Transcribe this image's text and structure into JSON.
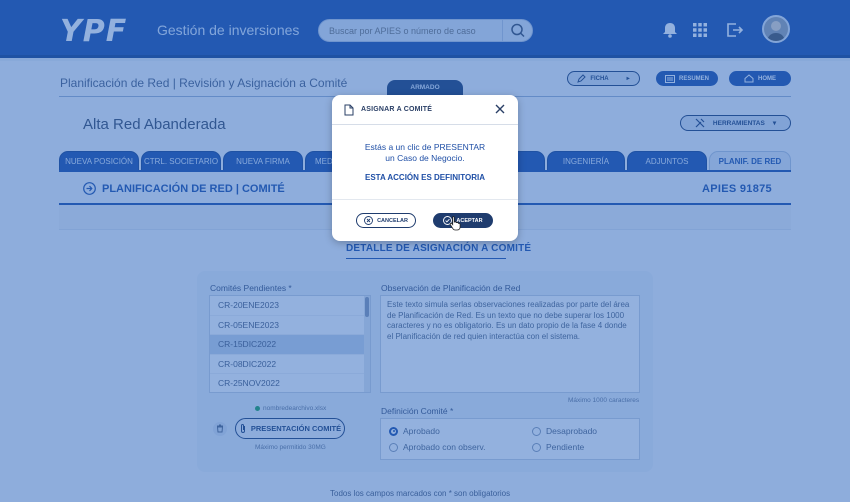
{
  "header": {
    "logo": "YPF",
    "app_title": "Gestión de inversiones",
    "search_placeholder": "Buscar por APIES o número de caso"
  },
  "breadcrumb": "Planificación de Red | Revisión y Asignación a Comité",
  "armado_tab": "ARMADO",
  "header_buttons": {
    "ficha": "FICHA",
    "resumen": "RESUMEN",
    "home": "HOME"
  },
  "subtitle": "Alta Red Abanderada",
  "herramientas": "HERRAMIENTAS",
  "tabs": [
    "NUEVA POSICIÓN",
    "CTRL. SOCIETARIO",
    "NUEVA FIRMA",
    "MEDI",
    "",
    "",
    "INGENIERÍA",
    "ADJUNTOS",
    "PLANIF. DE RED"
  ],
  "section": {
    "title": "PLANIFICACIÓN DE RED | COMITÉ",
    "apies": "APIES  91875"
  },
  "detail_title": "DETALLE DE ASIGNACIÓN A COMITÉ",
  "form": {
    "pending_label": "Comités Pendientes *",
    "committees": [
      "CR-20ENE2023",
      "CR-05ENE2023",
      "CR-15DIC2022",
      "CR-08DIC2022",
      "CR-25NOV2022"
    ],
    "selected_committee": "CR-15DIC2022",
    "obs_label": "Observación de Planificación de Red",
    "obs_text": "Este texto simula serlas observaciones realizadas por parte del área de Planificación de Red. Es un texto que no debe superar los 1000 caracteres y no es obligatorio. Es un dato propio de la fase 4 donde el Planificación de red quien interactúa con el sistema.",
    "max_chars": "Máximo 1000 caracteres",
    "file_name": "nombredearchivo.xlsx",
    "present_button": "PRESENTACIÓN COMITÉ",
    "max_mg": "Máximo permitido 30MG",
    "def_label": "Definición Comité *",
    "radios": {
      "aprobado": "Aprobado",
      "desaprobado": "Desaprobado",
      "aprobado_obs": "Aprobado con observ.",
      "pendiente": "Pendiente"
    },
    "selected_radio": "Aprobado",
    "required_note": "Todos los campos marcados con * son obligatorios"
  },
  "modal": {
    "title": "ASIGNAR A COMITÉ",
    "message_line1": "Estás a un clic de PRESENTAR",
    "message_line2": "un Caso de Negocio.",
    "warning": "ESTA ACCIÓN ES DEFINITORIA",
    "cancel": "CANCELAR",
    "accept": "ACEPTAR"
  },
  "colors": {
    "brand": "#1f4fa6",
    "dark": "#1f3c6e",
    "success": "#1fa35a"
  }
}
